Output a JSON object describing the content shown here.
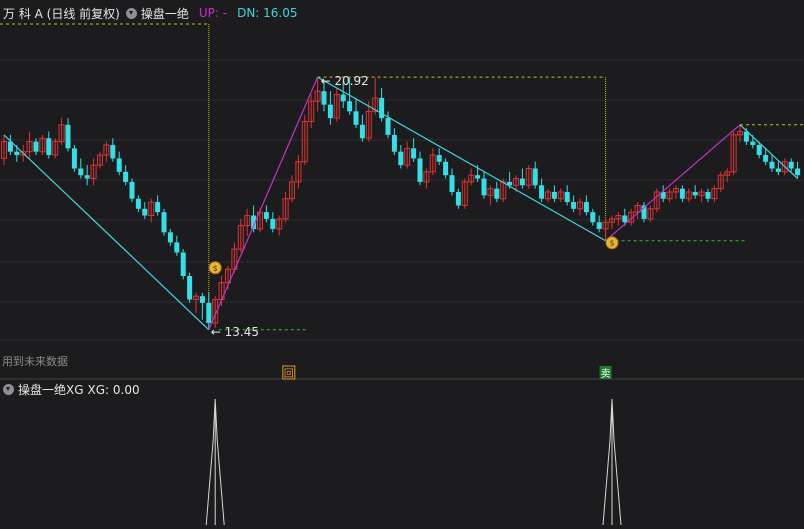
{
  "header": {
    "stock_name": "万 科 A (日线 前复权)",
    "indicator_name": "操盘一绝",
    "up_label": "UP: -",
    "dn_label": "DN: 16.05"
  },
  "subpanel": {
    "indicator_name": "操盘一绝XG",
    "value_label": "XG: 0.00"
  },
  "note": "用到未来数据",
  "colors": {
    "up_candle": "#e03333",
    "down_candle": "#33e0e8",
    "zigzag_up": "#c633c6",
    "zigzag_down": "#3fd6de",
    "guide_yellow": "#c8c000",
    "guide_green": "#2ac02a",
    "background": "#1c1c1e"
  },
  "chart_data": {
    "type": "candlestick",
    "price_range": [
      12.5,
      22.5
    ],
    "grid": true,
    "annotations": [
      {
        "label": "20.92",
        "value": 20.92,
        "kind": "peak"
      },
      {
        "label": "13.45",
        "value": 13.45,
        "kind": "trough"
      }
    ],
    "signal_icons": [
      "money-bag-icon",
      "money-bag-icon"
    ],
    "bottom_markers": [
      "回",
      "卖"
    ],
    "candles": [
      [
        18.5,
        19.2,
        18.3,
        19.0
      ],
      [
        19.0,
        19.2,
        18.6,
        18.7
      ],
      [
        18.7,
        18.9,
        18.4,
        18.6
      ],
      [
        18.6,
        18.9,
        18.4,
        18.7
      ],
      [
        18.7,
        19.3,
        18.5,
        19.0
      ],
      [
        19.0,
        19.1,
        18.6,
        18.7
      ],
      [
        18.7,
        19.2,
        18.6,
        19.1
      ],
      [
        19.1,
        19.3,
        18.5,
        18.6
      ],
      [
        18.6,
        19.1,
        18.5,
        19.0
      ],
      [
        19.0,
        19.7,
        18.9,
        19.5
      ],
      [
        19.5,
        19.7,
        18.7,
        18.8
      ],
      [
        18.8,
        18.9,
        18.1,
        18.2
      ],
      [
        18.2,
        18.5,
        17.9,
        18.0
      ],
      [
        18.0,
        18.3,
        17.7,
        17.9
      ],
      [
        17.9,
        18.5,
        17.7,
        18.3
      ],
      [
        18.3,
        18.7,
        18.2,
        18.6
      ],
      [
        18.6,
        19.0,
        18.4,
        18.9
      ],
      [
        18.9,
        19.1,
        18.4,
        18.5
      ],
      [
        18.5,
        18.7,
        18.0,
        18.1
      ],
      [
        18.1,
        18.3,
        17.7,
        17.8
      ],
      [
        17.8,
        17.9,
        17.2,
        17.3
      ],
      [
        17.3,
        17.4,
        16.9,
        17.0
      ],
      [
        17.0,
        17.2,
        16.7,
        16.8
      ],
      [
        16.8,
        17.3,
        16.6,
        17.2
      ],
      [
        17.2,
        17.4,
        16.8,
        16.9
      ],
      [
        16.9,
        17.0,
        16.2,
        16.3
      ],
      [
        16.3,
        16.4,
        15.9,
        16.0
      ],
      [
        16.0,
        16.2,
        15.6,
        15.7
      ],
      [
        15.7,
        15.8,
        14.9,
        15.0
      ],
      [
        15.0,
        15.1,
        14.2,
        14.3
      ],
      [
        14.3,
        14.5,
        13.9,
        14.4
      ],
      [
        14.4,
        14.5,
        13.7,
        14.2
      ],
      [
        14.2,
        14.5,
        13.4,
        13.6
      ],
      [
        13.6,
        14.4,
        13.45,
        14.3
      ],
      [
        14.3,
        15.0,
        14.1,
        14.8
      ],
      [
        14.8,
        15.3,
        14.6,
        15.2
      ],
      [
        15.2,
        16.0,
        15.1,
        15.8
      ],
      [
        15.8,
        16.7,
        15.7,
        16.5
      ],
      [
        16.5,
        17.0,
        16.2,
        16.8
      ],
      [
        16.8,
        17.1,
        16.3,
        16.4
      ],
      [
        16.4,
        17.0,
        16.3,
        16.9
      ],
      [
        16.9,
        17.1,
        16.6,
        16.7
      ],
      [
        16.7,
        16.9,
        16.3,
        16.4
      ],
      [
        16.4,
        16.8,
        16.2,
        16.7
      ],
      [
        16.7,
        17.5,
        16.6,
        17.3
      ],
      [
        17.3,
        18.0,
        17.2,
        17.8
      ],
      [
        17.8,
        18.6,
        17.6,
        18.4
      ],
      [
        18.4,
        19.8,
        18.3,
        19.6
      ],
      [
        19.6,
        20.4,
        19.4,
        20.2
      ],
      [
        20.2,
        20.92,
        19.9,
        20.5
      ],
      [
        20.5,
        20.8,
        19.9,
        20.1
      ],
      [
        20.1,
        20.5,
        19.5,
        19.7
      ],
      [
        19.7,
        20.6,
        19.6,
        20.4
      ],
      [
        20.4,
        20.8,
        20.0,
        20.2
      ],
      [
        20.2,
        20.9,
        19.8,
        19.9
      ],
      [
        19.9,
        20.3,
        19.4,
        19.5
      ],
      [
        19.5,
        19.8,
        19.0,
        19.1
      ],
      [
        19.1,
        20.2,
        19.0,
        19.9
      ],
      [
        19.9,
        20.9,
        19.8,
        20.3
      ],
      [
        20.3,
        20.6,
        19.6,
        19.7
      ],
      [
        19.7,
        19.9,
        19.1,
        19.2
      ],
      [
        19.2,
        19.4,
        18.6,
        18.7
      ],
      [
        18.7,
        18.9,
        18.2,
        18.3
      ],
      [
        18.3,
        19.0,
        18.2,
        18.8
      ],
      [
        18.8,
        19.1,
        18.4,
        18.5
      ],
      [
        18.5,
        18.7,
        17.7,
        17.8
      ],
      [
        17.8,
        18.2,
        17.6,
        18.1
      ],
      [
        18.1,
        18.8,
        18.0,
        18.6
      ],
      [
        18.6,
        18.8,
        18.3,
        18.4
      ],
      [
        18.4,
        18.5,
        17.9,
        18.0
      ],
      [
        18.0,
        18.2,
        17.4,
        17.5
      ],
      [
        17.5,
        17.6,
        17.0,
        17.1
      ],
      [
        17.1,
        17.9,
        17.0,
        17.8
      ],
      [
        17.8,
        18.2,
        17.7,
        18.0
      ],
      [
        18.0,
        18.3,
        17.8,
        17.9
      ],
      [
        17.9,
        18.1,
        17.3,
        17.4
      ],
      [
        17.4,
        17.7,
        17.1,
        17.6
      ],
      [
        17.6,
        17.8,
        17.2,
        17.3
      ],
      [
        17.3,
        17.9,
        17.2,
        17.8
      ],
      [
        17.8,
        18.1,
        17.6,
        17.7
      ],
      [
        17.7,
        18.0,
        17.5,
        17.9
      ],
      [
        17.9,
        18.2,
        17.6,
        17.7
      ],
      [
        17.7,
        18.3,
        17.6,
        18.2
      ],
      [
        18.2,
        18.4,
        17.6,
        17.7
      ],
      [
        17.7,
        17.9,
        17.2,
        17.3
      ],
      [
        17.3,
        17.6,
        17.2,
        17.5
      ],
      [
        17.5,
        17.7,
        17.2,
        17.3
      ],
      [
        17.3,
        17.6,
        17.2,
        17.5
      ],
      [
        17.5,
        17.7,
        17.1,
        17.2
      ],
      [
        17.2,
        17.4,
        16.9,
        17.0
      ],
      [
        17.0,
        17.3,
        16.8,
        17.2
      ],
      [
        17.2,
        17.4,
        16.8,
        16.9
      ],
      [
        16.9,
        17.0,
        16.5,
        16.6
      ],
      [
        16.6,
        16.8,
        16.3,
        16.4
      ],
      [
        16.4,
        16.7,
        16.05,
        16.6
      ],
      [
        16.6,
        16.8,
        16.4,
        16.7
      ],
      [
        16.7,
        16.9,
        16.5,
        16.8
      ],
      [
        16.8,
        17.0,
        16.5,
        16.6
      ],
      [
        16.6,
        17.0,
        16.5,
        16.9
      ],
      [
        16.9,
        17.2,
        16.7,
        17.1
      ],
      [
        17.1,
        17.2,
        16.6,
        16.7
      ],
      [
        16.7,
        17.1,
        16.6,
        17.0
      ],
      [
        17.0,
        17.6,
        16.9,
        17.5
      ],
      [
        17.5,
        17.7,
        17.2,
        17.3
      ],
      [
        17.3,
        17.6,
        17.2,
        17.5
      ],
      [
        17.5,
        17.7,
        17.3,
        17.6
      ],
      [
        17.6,
        17.7,
        17.2,
        17.3
      ],
      [
        17.3,
        17.6,
        17.2,
        17.5
      ],
      [
        17.5,
        17.7,
        17.3,
        17.4
      ],
      [
        17.4,
        17.6,
        17.2,
        17.5
      ],
      [
        17.5,
        17.6,
        17.2,
        17.3
      ],
      [
        17.3,
        17.7,
        17.2,
        17.6
      ],
      [
        17.6,
        18.1,
        17.5,
        18.0
      ],
      [
        18.0,
        18.2,
        17.8,
        18.1
      ],
      [
        18.1,
        19.3,
        18.0,
        19.2
      ],
      [
        19.2,
        19.5,
        19.0,
        19.3
      ],
      [
        19.3,
        19.4,
        18.9,
        19.0
      ],
      [
        19.0,
        19.2,
        18.8,
        18.9
      ],
      [
        18.9,
        19.0,
        18.5,
        18.6
      ],
      [
        18.6,
        18.8,
        18.3,
        18.4
      ],
      [
        18.4,
        18.6,
        18.1,
        18.2
      ],
      [
        18.2,
        18.4,
        18.0,
        18.1
      ],
      [
        18.1,
        18.5,
        18.0,
        18.4
      ],
      [
        18.4,
        18.5,
        18.1,
        18.2
      ],
      [
        18.2,
        18.4,
        17.9,
        18.0
      ]
    ]
  }
}
